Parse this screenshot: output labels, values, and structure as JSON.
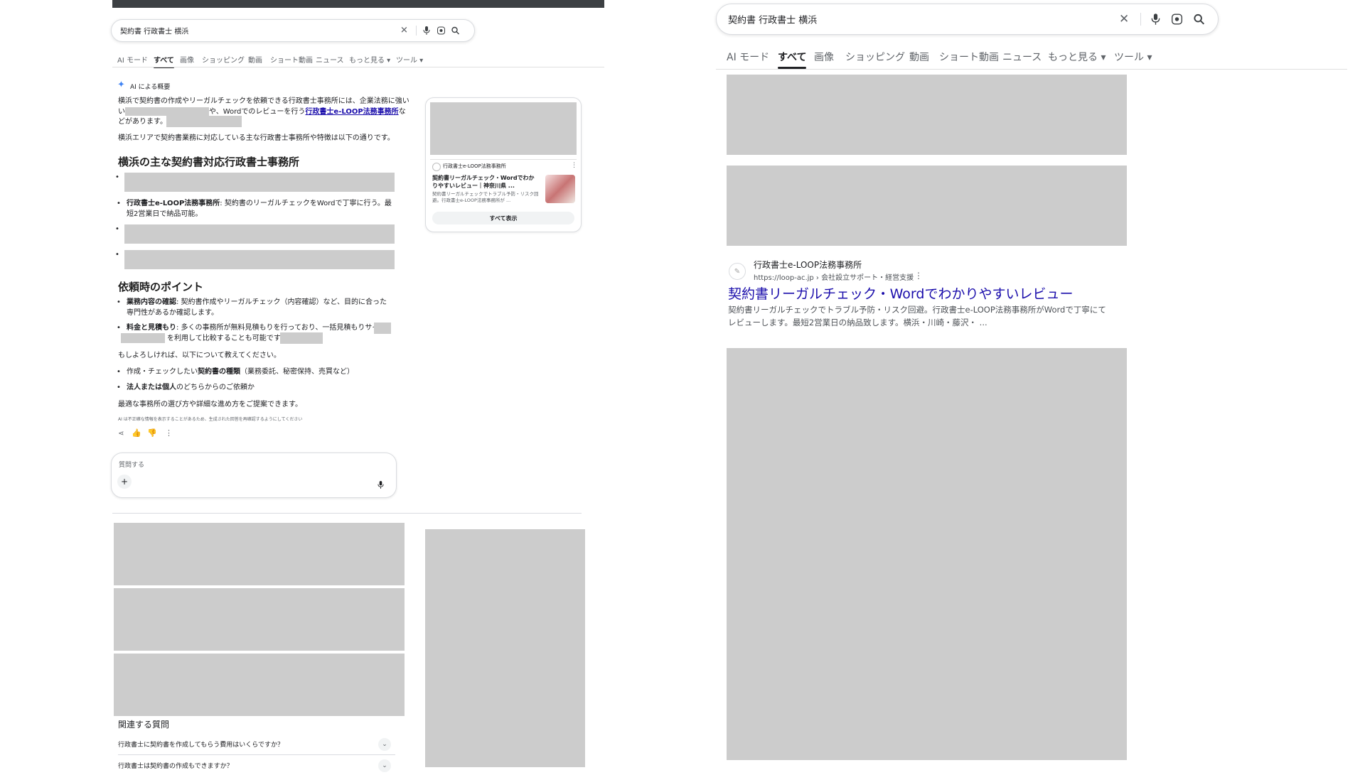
{
  "left": {
    "search": {
      "query": "契約書 行政書士 横浜"
    },
    "tabs": [
      "AI モード",
      "すべて",
      "画像",
      "ショッピング",
      "動画",
      "ショート動画",
      "ニュース",
      "もっと見る ▾",
      "ツール ▾"
    ],
    "ai_overview": {
      "label": "AI による概要",
      "intro_1": "横浜で契約書の作成やリーガルチェックを依頼できる行政書士事務所には、企業法務に強い",
      "intro_2": "や、Wordでのレビューを行う",
      "intro_link": "行政書士e-LOOP法務事務所",
      "intro_3": "な",
      "intro_4": "どがあります。",
      "sentence": "横浜エリアで契約書業務に対応している主な行政書士事務所や特徴は以下の通りです。",
      "heading_1": "横浜の主な契約書対応行政書士事務所",
      "office_name": "行政書士e-LOOP法務事務所",
      "office_desc": ": 契約書のリーガルチェックをWordで丁寧に行う。最短2営業日で納品可能。",
      "heading_2": "依頼時のポイント",
      "point1_label": "業務内容の確認",
      "point1_text": ": 契約書作成やリーガルチェック（内容確認）など、目的に合った専門性があるか確認します。",
      "point2_label": "料金と見積もり",
      "point2_text_a": ": 多くの事務所が無料見積もりを行っており、一括見積もりサイト",
      "point2_text_b": "を利用して比較することも可能です。",
      "ask": "もしよろしければ、以下について教えてください。",
      "q1_a": "作成・チェックしたい",
      "q1_b": "契約書の種類",
      "q1_c": "（業務委託、秘密保持、売買など）",
      "q2_a": "法人または個人",
      "q2_b": "のどちらからのご依頼か",
      "closing": "最適な事務所の選び方や詳細な進め方をご提案できます。",
      "disclaimer": "AI は不正確な情報を表示することがあるため、生成された回答を再確認するようにしてください"
    },
    "ask_box": {
      "placeholder": "質問する"
    },
    "side_card": {
      "source": "行政書士e-LOOP法務事務所",
      "title": "契約書リーガルチェック・Wordでわかりやすいレビュー｜神奈川県 ...",
      "snippet": "契約書リーガルチェックでトラブル予防・リスク回避。行政書士e-LOOP法務事務所が ...",
      "show_all": "すべて表示"
    },
    "related": {
      "title": "関連する質問",
      "q1": "行政書士に契約書を作成してもらう費用はいくらですか？",
      "q2": "行政書士は契約書の作成もできますか？"
    }
  },
  "right": {
    "search": {
      "query": "契約書 行政書士 横浜"
    },
    "tabs": [
      "AI モード",
      "すべて",
      "画像",
      "ショッピング",
      "動画",
      "ショート動画",
      "ニュース",
      "もっと見る ▾",
      "ツール ▾"
    ],
    "result": {
      "site_name": "行政書士e-LOOP法務事務所",
      "url": "https://loop-ac.jp › 会社設立サポート・経営支援",
      "title": "契約書リーガルチェック・Wordでわかりやすいレビュー",
      "snippet_1": "契約書リーガルチェックでトラブル予防・リスク回避。行政書士e-LOOP法務事務所がWordで丁寧にて",
      "snippet_2": "レビューします。最短2営業日の納品致します。横浜・川崎・藤沢・ ..."
    }
  },
  "colors": {
    "link": "#1a0dab",
    "placeholder_gray": "#cccccc",
    "top_bar": "#3c4043"
  }
}
